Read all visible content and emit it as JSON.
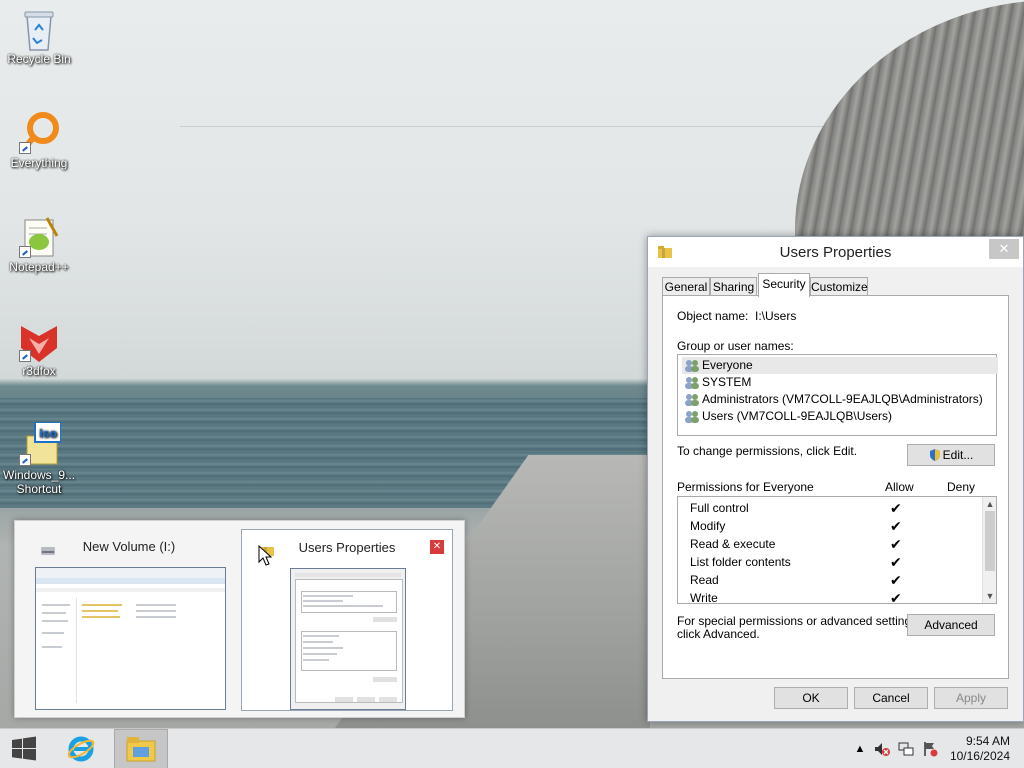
{
  "desktop": {
    "icons": [
      {
        "label": "Recycle Bin",
        "icon": "recycle-bin-icon"
      },
      {
        "label": "Everything",
        "icon": "everything-search-icon"
      },
      {
        "label": "Notepad++",
        "icon": "notepad-plus-plus-icon"
      },
      {
        "label": "r3dfox",
        "icon": "r3dfox-icon"
      },
      {
        "label": "Windows_9...\nShortcut",
        "label_line1": "Windows_9...",
        "label_line2": "Shortcut",
        "icon": "iso-file-icon"
      }
    ]
  },
  "dialog": {
    "title": "Users Properties",
    "close_label": "✕",
    "tabs": [
      {
        "label": "General"
      },
      {
        "label": "Sharing"
      },
      {
        "label": "Security"
      },
      {
        "label": "Customize"
      }
    ],
    "active_tab": "Security",
    "object_name_label": "Object name:",
    "object_name_value": "I:\\Users",
    "group_label": "Group or user names:",
    "users": [
      {
        "name": "Everyone"
      },
      {
        "name": "SYSTEM"
      },
      {
        "name": "Administrators (VM7COLL-9EAJLQB\\Administrators)"
      },
      {
        "name": "Users (VM7COLL-9EAJLQB\\Users)"
      }
    ],
    "change_perm_text": "To change permissions, click Edit.",
    "edit_label": "Edit...",
    "permissions_for": "Permissions for Everyone",
    "allow_header": "Allow",
    "deny_header": "Deny",
    "permissions": [
      {
        "name": "Full control",
        "allow": "✔",
        "deny": ""
      },
      {
        "name": "Modify",
        "allow": "✔",
        "deny": ""
      },
      {
        "name": "Read & execute",
        "allow": "✔",
        "deny": ""
      },
      {
        "name": "List folder contents",
        "allow": "✔",
        "deny": ""
      },
      {
        "name": "Read",
        "allow": "✔",
        "deny": ""
      },
      {
        "name": "Write",
        "allow": "✔",
        "deny": ""
      }
    ],
    "special_text_line1": "For special permissions or advanced settings,",
    "special_text_line2": "click Advanced.",
    "advanced_label": "Advanced",
    "ok_label": "OK",
    "cancel_label": "Cancel",
    "apply_label": "Apply"
  },
  "thumbnails": [
    {
      "title": "New Volume (I:)"
    },
    {
      "title": "Users Properties",
      "close_label": "✕"
    }
  ],
  "taskbar": {
    "time": "9:54 AM",
    "date": "10/16/2024"
  },
  "colors": {
    "taskbar": "#e4e6e8",
    "dialog_bg": "#f0f0f0",
    "thumb_close": "#d83b3b",
    "accent_blue": "#1e5fbf"
  }
}
